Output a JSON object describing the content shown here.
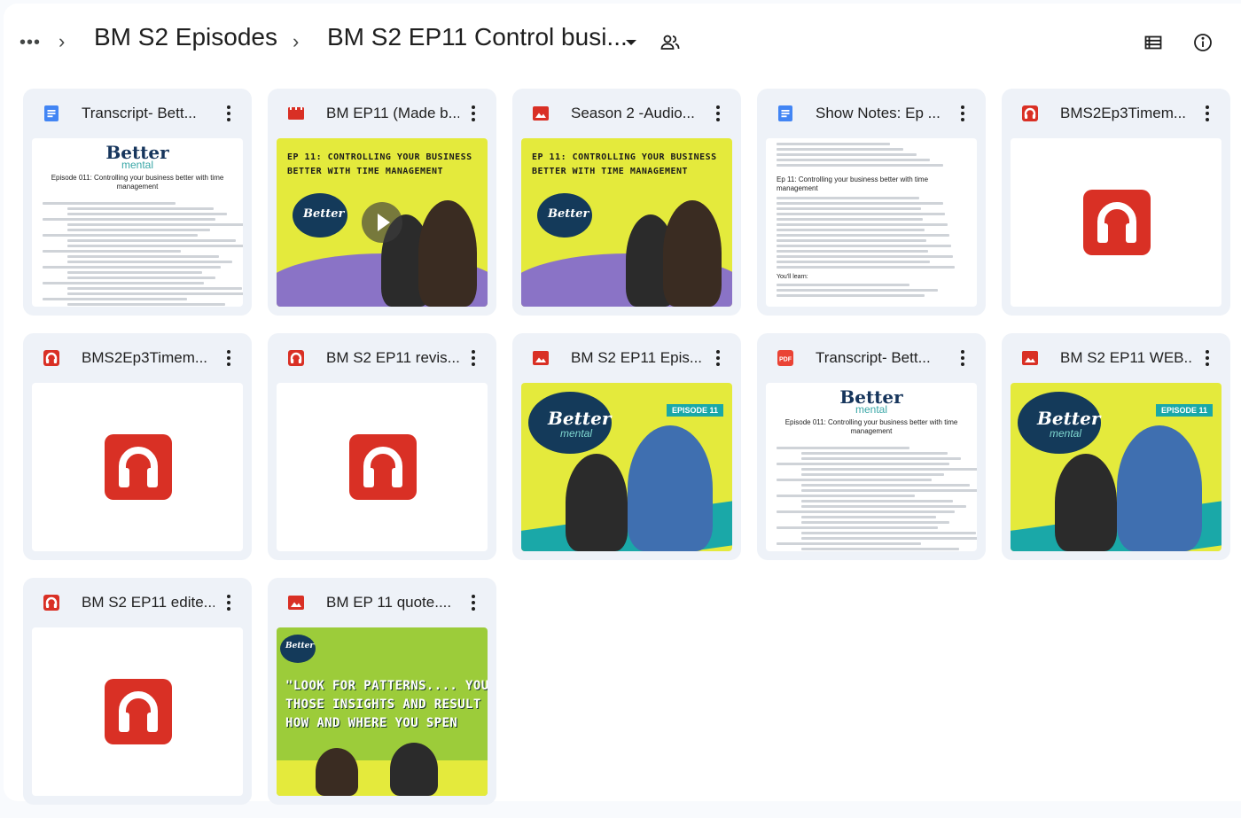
{
  "header": {
    "more_label": "•••",
    "sep1": "›",
    "crumb_parent": "BM S2 Episodes",
    "sep2": "›",
    "crumb_current": "BM S2 EP11 Control busi...",
    "dropdown_icon": "chevron-down-icon",
    "shared_icon": "people-icon",
    "view_icon": "list-view-icon",
    "info_icon": "info-icon"
  },
  "colors": {
    "doc_blue": "#4285f4",
    "video_red": "#d93025",
    "image_red": "#d93025",
    "audio_red": "#d93025",
    "pdf_red": "#ea4335",
    "card_bg": "#eef2f8",
    "brand_yellow": "#e4ea3c",
    "brand_purple": "#8a73c6",
    "brand_navy": "#143a5a",
    "brand_green": "#9ccc3a"
  },
  "files": [
    {
      "name": "Transcript- Bett...",
      "type": "doc",
      "icon": "google-docs-icon",
      "thumb": "transcript",
      "doc_logo": "Better",
      "doc_logo2": "mental",
      "doc_ep": "Episode 011: Controlling your business better with time management"
    },
    {
      "name": "BM EP11 (Made b...",
      "type": "video",
      "icon": "video-icon",
      "thumb": "video",
      "art_title": "EP 11: CONTROLLING YOUR BUSINESS BETTER WITH TIME MANAGEMENT",
      "logo": "Better"
    },
    {
      "name": "Season 2 -Audio...",
      "type": "image",
      "icon": "image-icon",
      "thumb": "image",
      "art_title": "EP 11: CONTROLLING YOUR BUSINESS BETTER WITH TIME MANAGEMENT",
      "logo": "Better"
    },
    {
      "name": "Show Notes: Ep ...",
      "type": "doc",
      "icon": "google-docs-icon",
      "thumb": "notes",
      "notes_heading": "Ep 11: Controlling your business better with time management",
      "notes_learn": "You'll learn:"
    },
    {
      "name": "BMS2Ep3Timem...",
      "type": "audio",
      "icon": "audio-icon",
      "thumb": "audio"
    },
    {
      "name": "BMS2Ep3Timem...",
      "type": "audio",
      "icon": "audio-icon",
      "thumb": "audio"
    },
    {
      "name": "BM S2 EP11 revis...",
      "type": "audio",
      "icon": "audio-icon",
      "thumb": "audio"
    },
    {
      "name": "BM S2 EP11 Epis...",
      "type": "image",
      "icon": "image-icon",
      "thumb": "episode",
      "logo": "Better",
      "logo2": "mental",
      "badge": "EPISODE 11"
    },
    {
      "name": "Transcript- Bett...",
      "type": "pdf",
      "icon": "pdf-icon",
      "pdf_label": "PDF",
      "thumb": "transcript",
      "doc_logo": "Better",
      "doc_logo2": "mental",
      "doc_ep": "Episode 011: Controlling your business better with time management"
    },
    {
      "name": "BM S2 EP11 WEB...",
      "type": "image",
      "icon": "image-icon",
      "thumb": "episode",
      "logo": "Better",
      "logo2": "mental",
      "badge": "EPISODE 11"
    },
    {
      "name": "BM S2 EP11 edite...",
      "type": "audio",
      "icon": "audio-icon",
      "thumb": "audio"
    },
    {
      "name": "BM EP 11 quote....",
      "type": "image",
      "icon": "image-icon",
      "thumb": "quote",
      "logo": "Better",
      "quote_lines": [
        "\"LOOK FOR PATTERNS.... YOU",
        "THOSE INSIGHTS AND RESULT",
        "HOW AND WHERE YOU SPEN"
      ]
    }
  ]
}
